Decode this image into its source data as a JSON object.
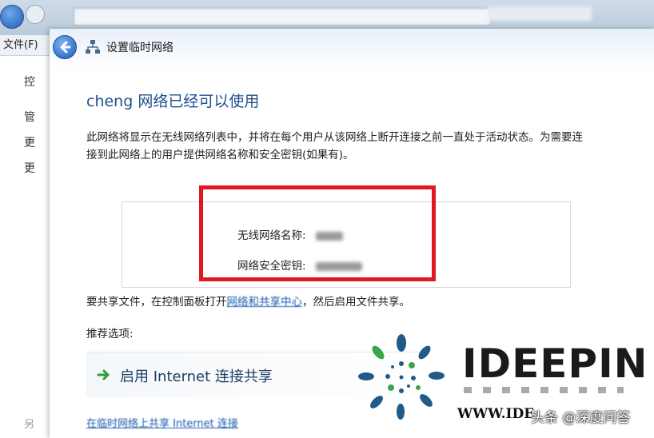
{
  "background_window": {
    "menu_file": "文件(F)",
    "side_items": [
      "控",
      "管",
      "更",
      "更"
    ],
    "bottom_partial": "另"
  },
  "dialog": {
    "title": "设置临时网络",
    "heading": "cheng 网络已经可以使用",
    "description": "此网络将显示在无线网络列表中，并将在每个用户从该网络上断开连接之前一直处于活动状态。为需要连接到此网络上的用户提供网络名称和安全密钥(如果有)。",
    "network_name_label": "无线网络名称:",
    "security_key_label": "网络安全密钥:",
    "share_prefix": "要共享文件，在控制面板打开",
    "share_link": "网络和共享中心",
    "share_suffix": "，然后启用文件共享。",
    "recommended_label": "推荐选项:",
    "option_label": "启用 Internet 连接共享",
    "bottom_link": "在临时网络上共享 Internet 连接"
  },
  "watermark": {
    "brand": "IDEEPIN",
    "url": "WWW.IDE",
    "credit": "头条 @深度问答"
  },
  "colors": {
    "highlight_border": "#e0191f",
    "heading": "#1f4f8f",
    "link": "#1a5db0"
  }
}
